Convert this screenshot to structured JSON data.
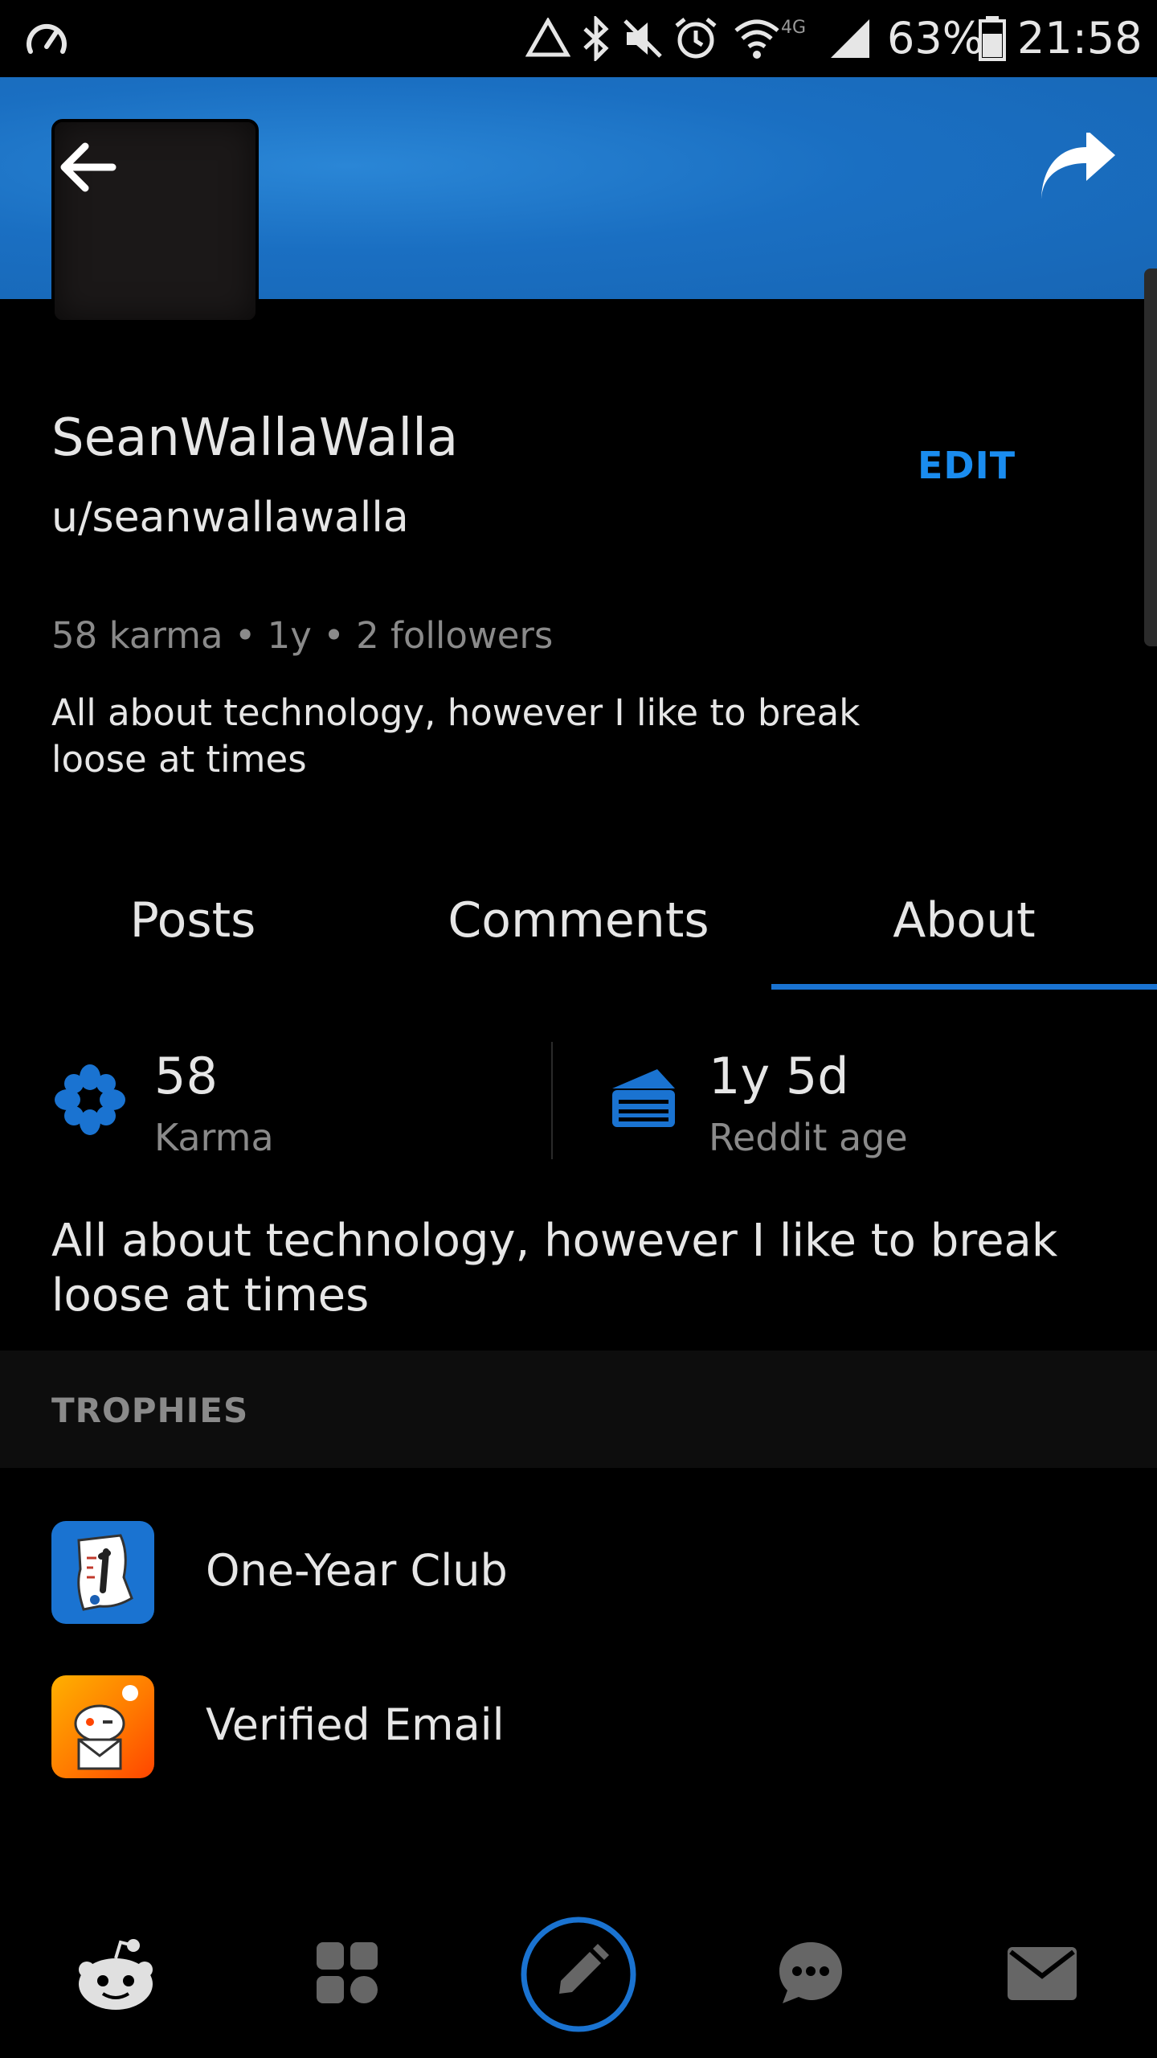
{
  "status_bar": {
    "battery": "63%",
    "time": "21:58"
  },
  "profile": {
    "display_name": "SeanWallaWalla",
    "username": "u/seanwallawalla",
    "edit_label": "EDIT",
    "meta": "58 karma • 1y • 2 followers",
    "bio": "All about technology, however I like to break loose at times"
  },
  "tabs": [
    {
      "label": "Posts"
    },
    {
      "label": "Comments"
    },
    {
      "label": "About",
      "active": true
    }
  ],
  "stats": {
    "karma_value": "58",
    "karma_label": "Karma",
    "age_value": "1y 5d",
    "age_label": "Reddit age"
  },
  "about_bio": "All about technology, however I like to break loose at times",
  "trophies": {
    "title": "TROPHIES",
    "items": [
      {
        "label": "One-Year Club"
      },
      {
        "label": "Verified Email"
      }
    ]
  },
  "colors": {
    "accent": "#1a8cef",
    "banner": "#1a6fc2"
  }
}
